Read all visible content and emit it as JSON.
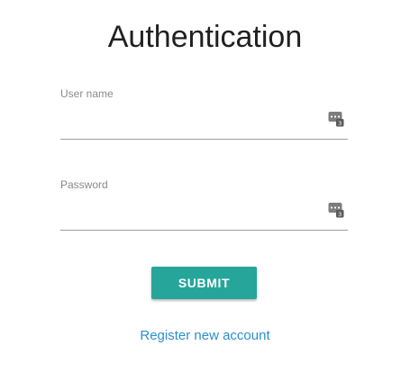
{
  "page": {
    "title": "Authentication"
  },
  "form": {
    "username": {
      "label": "User name",
      "value": "",
      "icon": "password-manager-icon"
    },
    "password": {
      "label": "Password",
      "value": "",
      "icon": "password-manager-icon"
    },
    "submit_label": "SUBMIT",
    "register_link": "Register new account"
  },
  "colors": {
    "accent": "#26a69a",
    "link": "#2a8fd0",
    "underline": "#9e9e9e",
    "label": "#8a8a8a"
  }
}
